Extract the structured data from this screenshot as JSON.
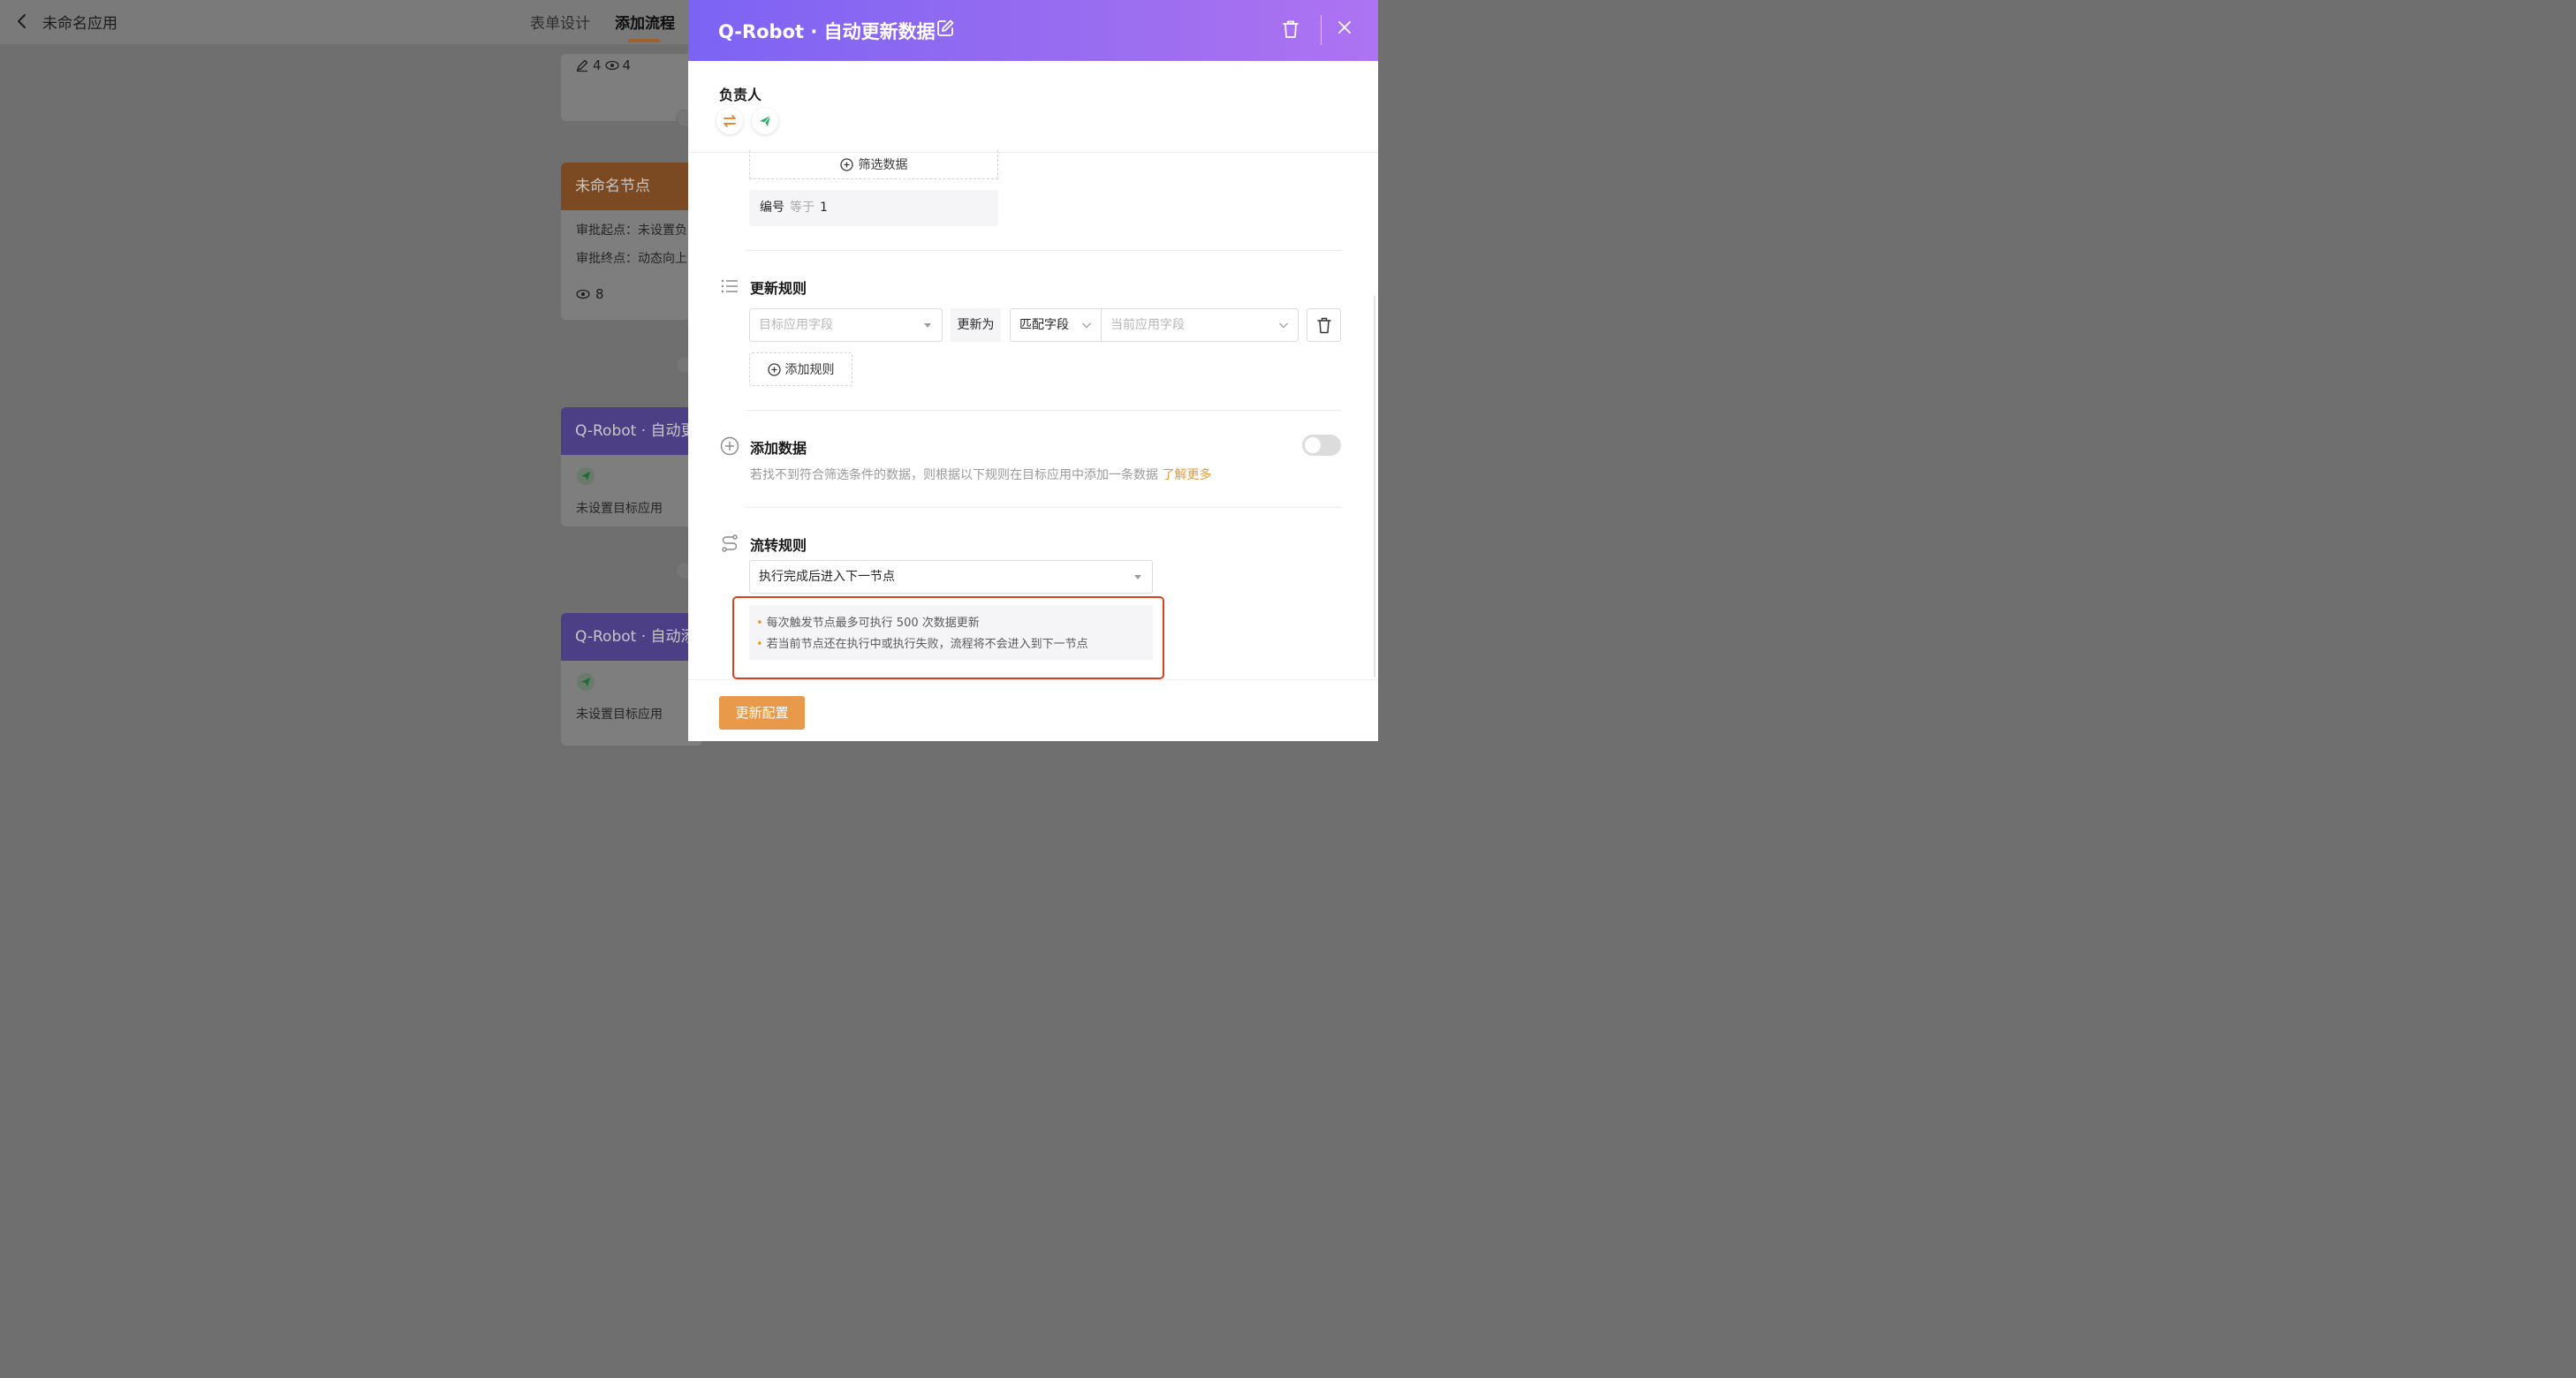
{
  "app": {
    "title": "未命名应用",
    "tabs": [
      {
        "label": "表单设计",
        "active": false
      },
      {
        "label": "添加流程",
        "active": true
      }
    ]
  },
  "canvas": {
    "top_card": {
      "edit_count": "4",
      "view_count": "4"
    },
    "cards": [
      {
        "title": "未命名节点",
        "color": "#7b4a22",
        "lines": [
          "审批起点：未设置负",
          "审批终点：动态向上"
        ],
        "view_count": "8"
      },
      {
        "title": "Q-Robot · 自动更新数据",
        "color": "#4d3f86",
        "icon": "send-icon",
        "status": "未设置目标应用"
      },
      {
        "title": "Q-Robot · 自动添加数据",
        "color": "#4d3f86",
        "icon": "send-icon",
        "status": "未设置目标应用"
      }
    ]
  },
  "drawer": {
    "title": "Q-Robot · 自动更新数据",
    "header_gradient": [
      "#7c63f4",
      "#ad73f2"
    ],
    "owner": {
      "label": "负责人",
      "icons": [
        "swap-icon",
        "send-icon"
      ]
    },
    "filter": {
      "button_label": "筛选数据",
      "condition": {
        "field": "编号",
        "operator": "等于",
        "value": "1"
      }
    },
    "update_rules": {
      "title": "更新规则",
      "target_field_placeholder": "目标应用字段",
      "update_to_label": "更新为",
      "match_mode": "匹配字段",
      "current_field_placeholder": "当前应用字段",
      "add_rule_label": "添加规则"
    },
    "add_data": {
      "title": "添加数据",
      "enabled": false,
      "description": "若找不到符合筛选条件的数据，则根据以下规则在目标应用中添加一条数据",
      "learn_more": "了解更多"
    },
    "flow_rules": {
      "title": "流转规则",
      "selected": "执行完成后进入下一节点",
      "notes": [
        "每次触发节点最多可执行 500 次数据更新",
        "若当前节点还在执行中或执行失败，流程将不会进入到下一节点"
      ]
    },
    "save_label": "更新配置",
    "accent_color": "#e89a4a",
    "highlight_color": "#d9411f"
  }
}
